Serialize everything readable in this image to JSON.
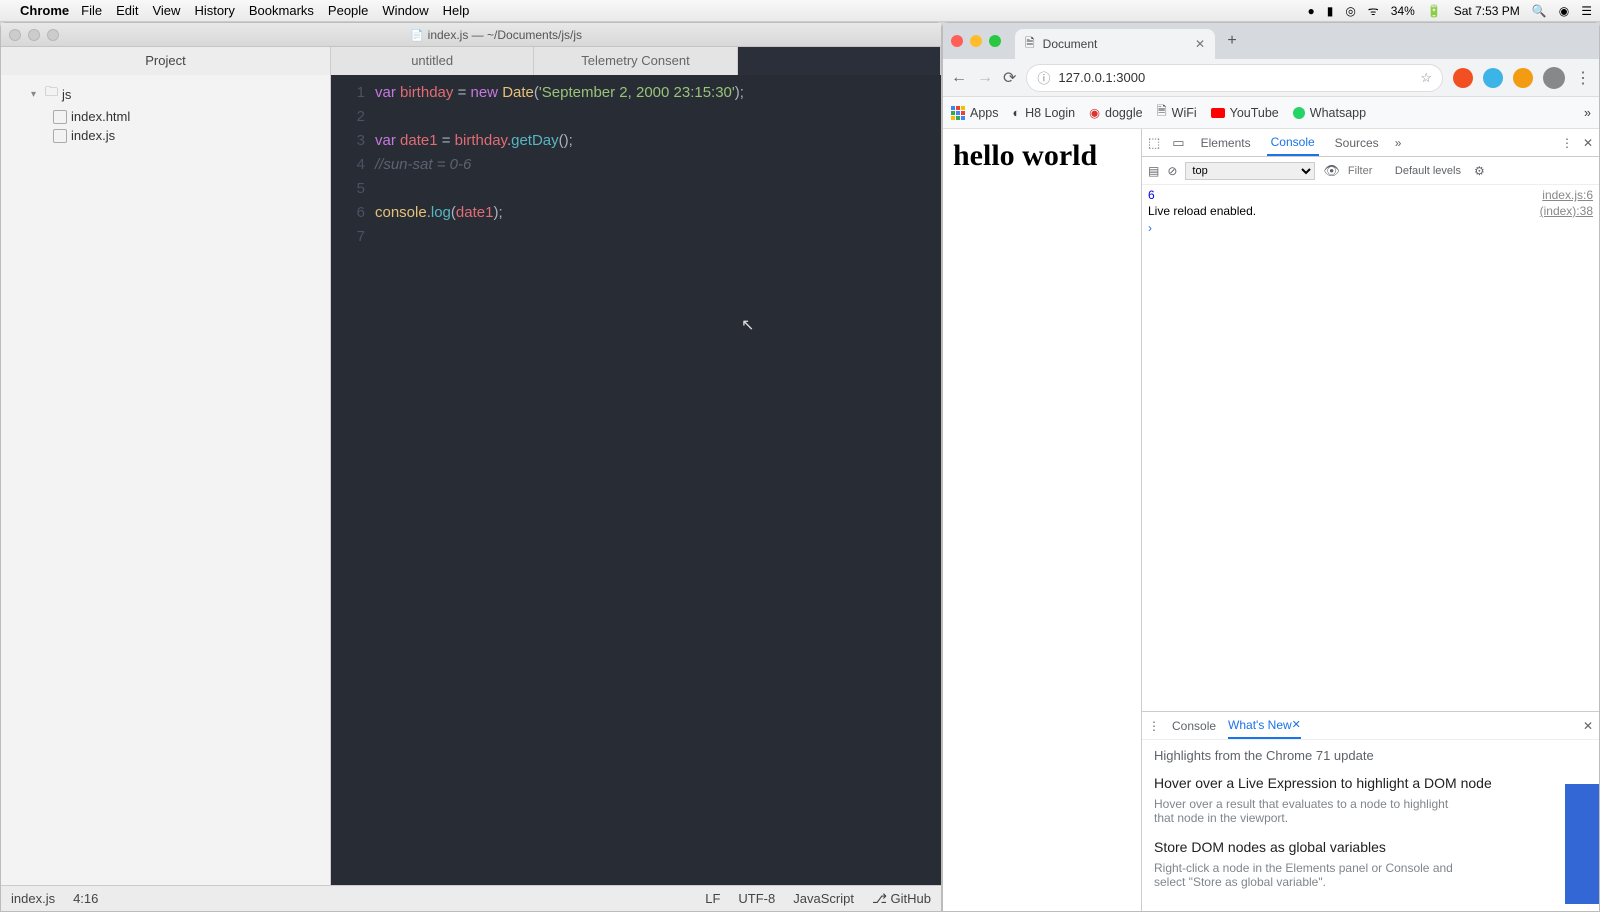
{
  "menubar": {
    "app": "Chrome",
    "items": [
      "File",
      "Edit",
      "View",
      "History",
      "Bookmarks",
      "People",
      "Window",
      "Help"
    ],
    "battery": "34%",
    "clock": "Sat 7:53 PM"
  },
  "editor": {
    "title": "index.js — ~/Documents/js/js",
    "project_tab": "Project",
    "tabs": [
      "untitled",
      "Telemetry Consent"
    ],
    "tree": {
      "root": "js",
      "files": [
        "index.html",
        "index.js"
      ]
    },
    "gutter": [
      "1",
      "2",
      "3",
      "4",
      "5",
      "6",
      "7"
    ],
    "code": {
      "l1": {
        "var": "var",
        "name": "birthday",
        "eq": "=",
        "new": "new",
        "cls": "Date",
        "open": "(",
        "str": "'September 2, 2000 23:15:30'",
        "close": ");"
      },
      "l3": {
        "var": "var",
        "name": "date1",
        "eq": "=",
        "obj": "birthday",
        "dot": ".",
        "meth": "getDay",
        "call": "();"
      },
      "l4": {
        "cmt": "//sun-sat = 0-6"
      },
      "l6": {
        "obj": "console",
        "dot": ".",
        "meth": "log",
        "open": "(",
        "arg": "date1",
        "close": ");"
      }
    },
    "status": {
      "file": "index.js",
      "pos": "4:16",
      "eol": "LF",
      "enc": "UTF-8",
      "lang": "JavaScript",
      "git": "GitHub"
    }
  },
  "chrome": {
    "tab_title": "Document",
    "url": "127.0.0.1:3000",
    "bookmarks": [
      "Apps",
      "H8 Login",
      "doggle",
      "WiFi",
      "YouTube",
      "Whatsapp"
    ],
    "page": {
      "heading": "hello world"
    },
    "devtools": {
      "tabs": [
        "Elements",
        "Console",
        "Sources"
      ],
      "filter_context": "top",
      "filter_placeholder": "Filter",
      "levels": "Default levels",
      "lines": [
        {
          "val": "6",
          "src": "index.js:6"
        },
        {
          "val": "Live reload enabled.",
          "src": "(index):38"
        }
      ],
      "drawer": {
        "tabs": [
          "Console",
          "What's New"
        ],
        "highlight": "Highlights from the Chrome 71 update",
        "items": [
          {
            "h": "Hover over a Live Expression to highlight a DOM node",
            "p": "Hover over a result that evaluates to a node to highlight that node in the viewport."
          },
          {
            "h": "Store DOM nodes as global variables",
            "p": "Right-click a node in the Elements panel or Console and select \"Store as global variable\"."
          }
        ]
      }
    }
  }
}
